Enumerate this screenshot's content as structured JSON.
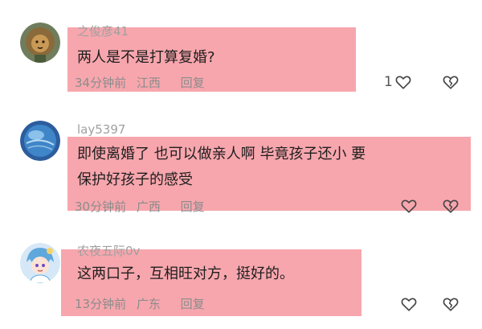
{
  "comments": [
    {
      "username": "之俊彦41",
      "text_lines": [
        "两人是不是打算复婚?"
      ],
      "time": "34分钟前",
      "location": "江西",
      "reply_label": "回复",
      "like_count": "1",
      "avatar_icon": "lion-avatar"
    },
    {
      "username": "lay5397",
      "text_lines": [
        "即使离婚了 也可以做亲人啊 毕竟孩子还小 要",
        "保护好孩子的感受"
      ],
      "time": "30分钟前",
      "location": "广西",
      "reply_label": "回复",
      "like_count": "",
      "avatar_icon": "blue-sphere-avatar"
    },
    {
      "username": "农夜五际0v",
      "text_lines": [
        "这两口子，互相旺对方，挺好的。"
      ],
      "time": "13分钟前",
      "location": "广东",
      "reply_label": "回复",
      "like_count": "",
      "avatar_icon": "anime-avatar"
    }
  ],
  "colors": {
    "highlight": "#f7a6ad",
    "meta_text": "#8c8c8c",
    "username_text": "#a0a0a0"
  }
}
